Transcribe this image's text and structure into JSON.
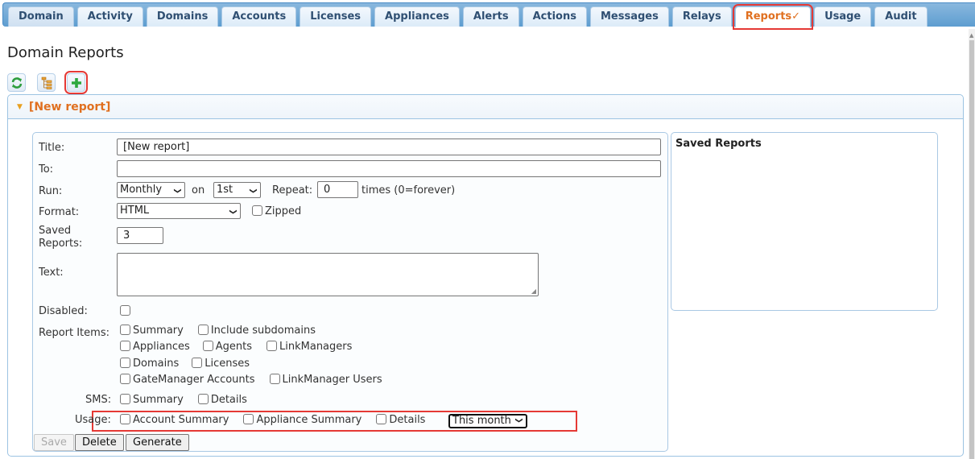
{
  "tabs": [
    {
      "label": "Domain",
      "active": false
    },
    {
      "label": "Activity",
      "active": false
    },
    {
      "label": "Domains",
      "active": false
    },
    {
      "label": "Accounts",
      "active": false
    },
    {
      "label": "Licenses",
      "active": false
    },
    {
      "label": "Appliances",
      "active": false
    },
    {
      "label": "Alerts",
      "active": false
    },
    {
      "label": "Actions",
      "active": false
    },
    {
      "label": "Messages",
      "active": false
    },
    {
      "label": "Relays",
      "active": false
    },
    {
      "label": "Reports",
      "active": true,
      "mark": "✓"
    },
    {
      "label": "Usage",
      "active": false
    },
    {
      "label": "Audit",
      "active": false
    }
  ],
  "page": {
    "title": "Domain Reports"
  },
  "toolbar": {
    "refresh_icon": "refresh-icon",
    "tree_icon": "tree-icon",
    "add_icon": "plus-icon"
  },
  "panel": {
    "header": "[New report]"
  },
  "form": {
    "title_label": "Title:",
    "title_value": "[New report]",
    "to_label": "To:",
    "to_value": "",
    "run_label": "Run:",
    "run_value": "Monthly",
    "on_label": "on",
    "on_value": "1st",
    "repeat_label": "Repeat:",
    "repeat_value": "0",
    "repeat_suffix": "times (0=forever)",
    "format_label": "Format:",
    "format_value": "HTML",
    "zipped_label": "Zipped",
    "saved_label_1": "Saved",
    "saved_label_2": "Reports:",
    "saved_value": "3",
    "text_label": "Text:",
    "text_value": "",
    "disabled_label": "Disabled:",
    "report_items_label": "Report Items:",
    "report_items": [
      [
        "Summary",
        "Include subdomains"
      ],
      [
        "Appliances",
        "Agents",
        "LinkManagers"
      ],
      [
        "Domains",
        "Licenses"
      ],
      [
        "GateManager Accounts",
        "LinkManager Users"
      ]
    ],
    "sms_label": "SMS:",
    "sms_items": [
      "Summary",
      "Details"
    ],
    "usage_label": "Usage:",
    "usage_items": [
      "Account Summary",
      "Appliance Summary",
      "Details"
    ],
    "usage_period": "This month",
    "buttons": {
      "save": "Save",
      "delete": "Delete",
      "generate": "Generate"
    }
  },
  "saved_reports": {
    "header": "Saved Reports"
  }
}
